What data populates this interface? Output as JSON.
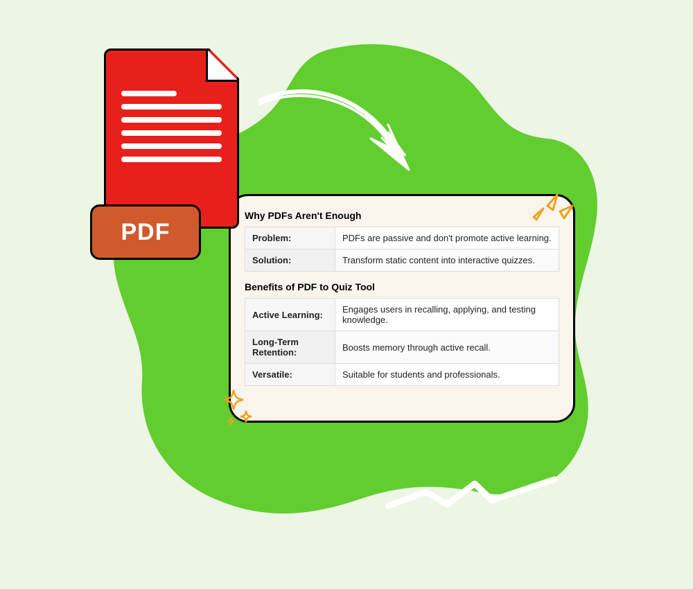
{
  "pdf": {
    "badge": "PDF"
  },
  "card": {
    "section1": {
      "title": "Why PDFs Aren't Enough",
      "rows": [
        {
          "label": "Problem:",
          "value": "PDFs are passive and don't promote active learning."
        },
        {
          "label": "Solution:",
          "value": "Transform static content into interactive quizzes."
        }
      ]
    },
    "section2": {
      "title": "Benefits of PDF to Quiz Tool",
      "rows": [
        {
          "label": "Active Learning:",
          "value": "Engages users in recalling, applying, and testing knowledge."
        },
        {
          "label": "Long-Term Retention:",
          "value": "Boosts memory through active recall."
        },
        {
          "label": "Versatile:",
          "value": "Suitable for students and professionals."
        }
      ]
    }
  }
}
